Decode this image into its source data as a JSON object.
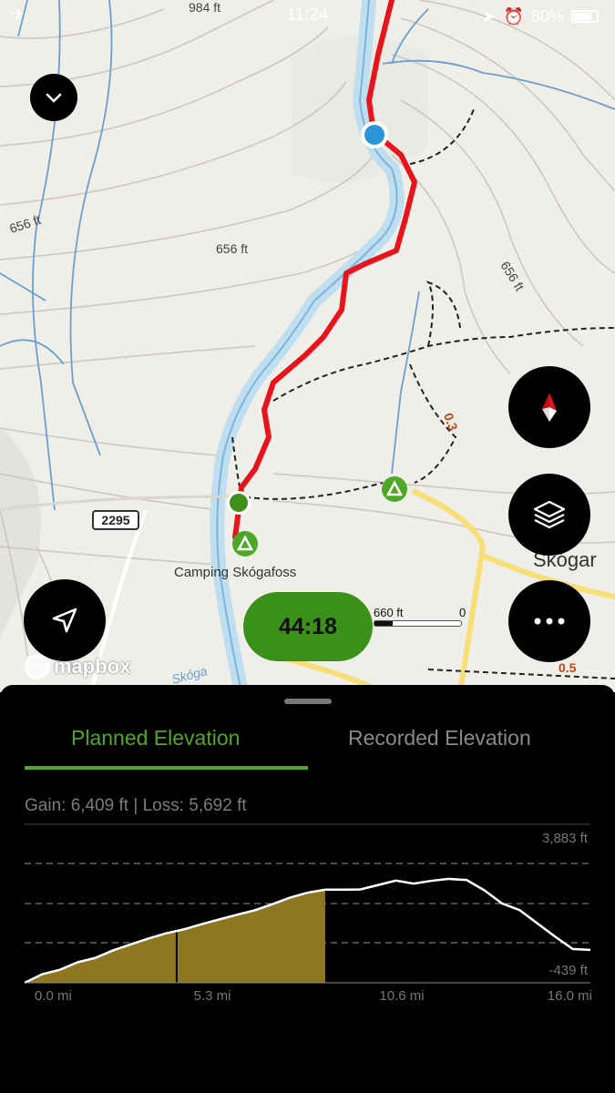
{
  "status_bar": {
    "time": "11:24",
    "battery": "80%"
  },
  "map": {
    "contour_labels": [
      "984 ft",
      "656 ft",
      "656 ft",
      "656 ft"
    ],
    "trail_marker": "0.3",
    "trail_marker_2": "0.5",
    "road_number": "2295",
    "campsite_name": "Camping Skógafoss",
    "town_name": "Skógar",
    "river_name": "Skóga",
    "attribution": "mapbox",
    "timer": "44:18",
    "scale_value": "660 ft",
    "scale_zero": "0",
    "colors": {
      "route": "#e8141b",
      "water": "#bfdff0",
      "accent": "#3b8f1b"
    }
  },
  "panel": {
    "tabs": [
      {
        "label": "Planned Elevation",
        "active": true
      },
      {
        "label": "Recorded Elevation",
        "active": false
      }
    ],
    "gain_loss": "Gain: 6,409 ft | Loss: 5,692 ft"
  },
  "chart_data": {
    "type": "area",
    "title": "",
    "xlabel": "",
    "ylabel": "",
    "ylim": [
      -439,
      3883
    ],
    "y_ticks_labels": [
      "3,883 ft",
      "-439 ft"
    ],
    "x_tick_labels": [
      "0.0 mi",
      "5.3 mi",
      "10.6 mi",
      "16.0 mi"
    ],
    "xlim": [
      0,
      16.0
    ],
    "x": [
      0,
      0.5,
      1,
      1.5,
      2,
      2.5,
      3,
      3.5,
      4,
      4.5,
      5,
      5.5,
      6,
      6.5,
      7,
      7.5,
      8,
      8.5,
      9,
      9.5,
      10,
      10.5,
      11,
      11.5,
      12,
      12.5,
      13,
      13.5,
      14,
      14.5,
      15,
      15.5,
      16.0
    ],
    "y": [
      -50,
      270,
      430,
      700,
      860,
      1130,
      1350,
      1560,
      1750,
      1890,
      2080,
      2250,
      2420,
      2580,
      2800,
      3040,
      3220,
      3330,
      3330,
      3340,
      3500,
      3660,
      3550,
      3650,
      3720,
      3680,
      3310,
      2830,
      2590,
      2110,
      1630,
      1180,
      1150
    ],
    "filled_to_mi": 8.5,
    "marker_mi": 4.3,
    "fill_color": "#8e7720",
    "line_color": "#ffffff"
  }
}
